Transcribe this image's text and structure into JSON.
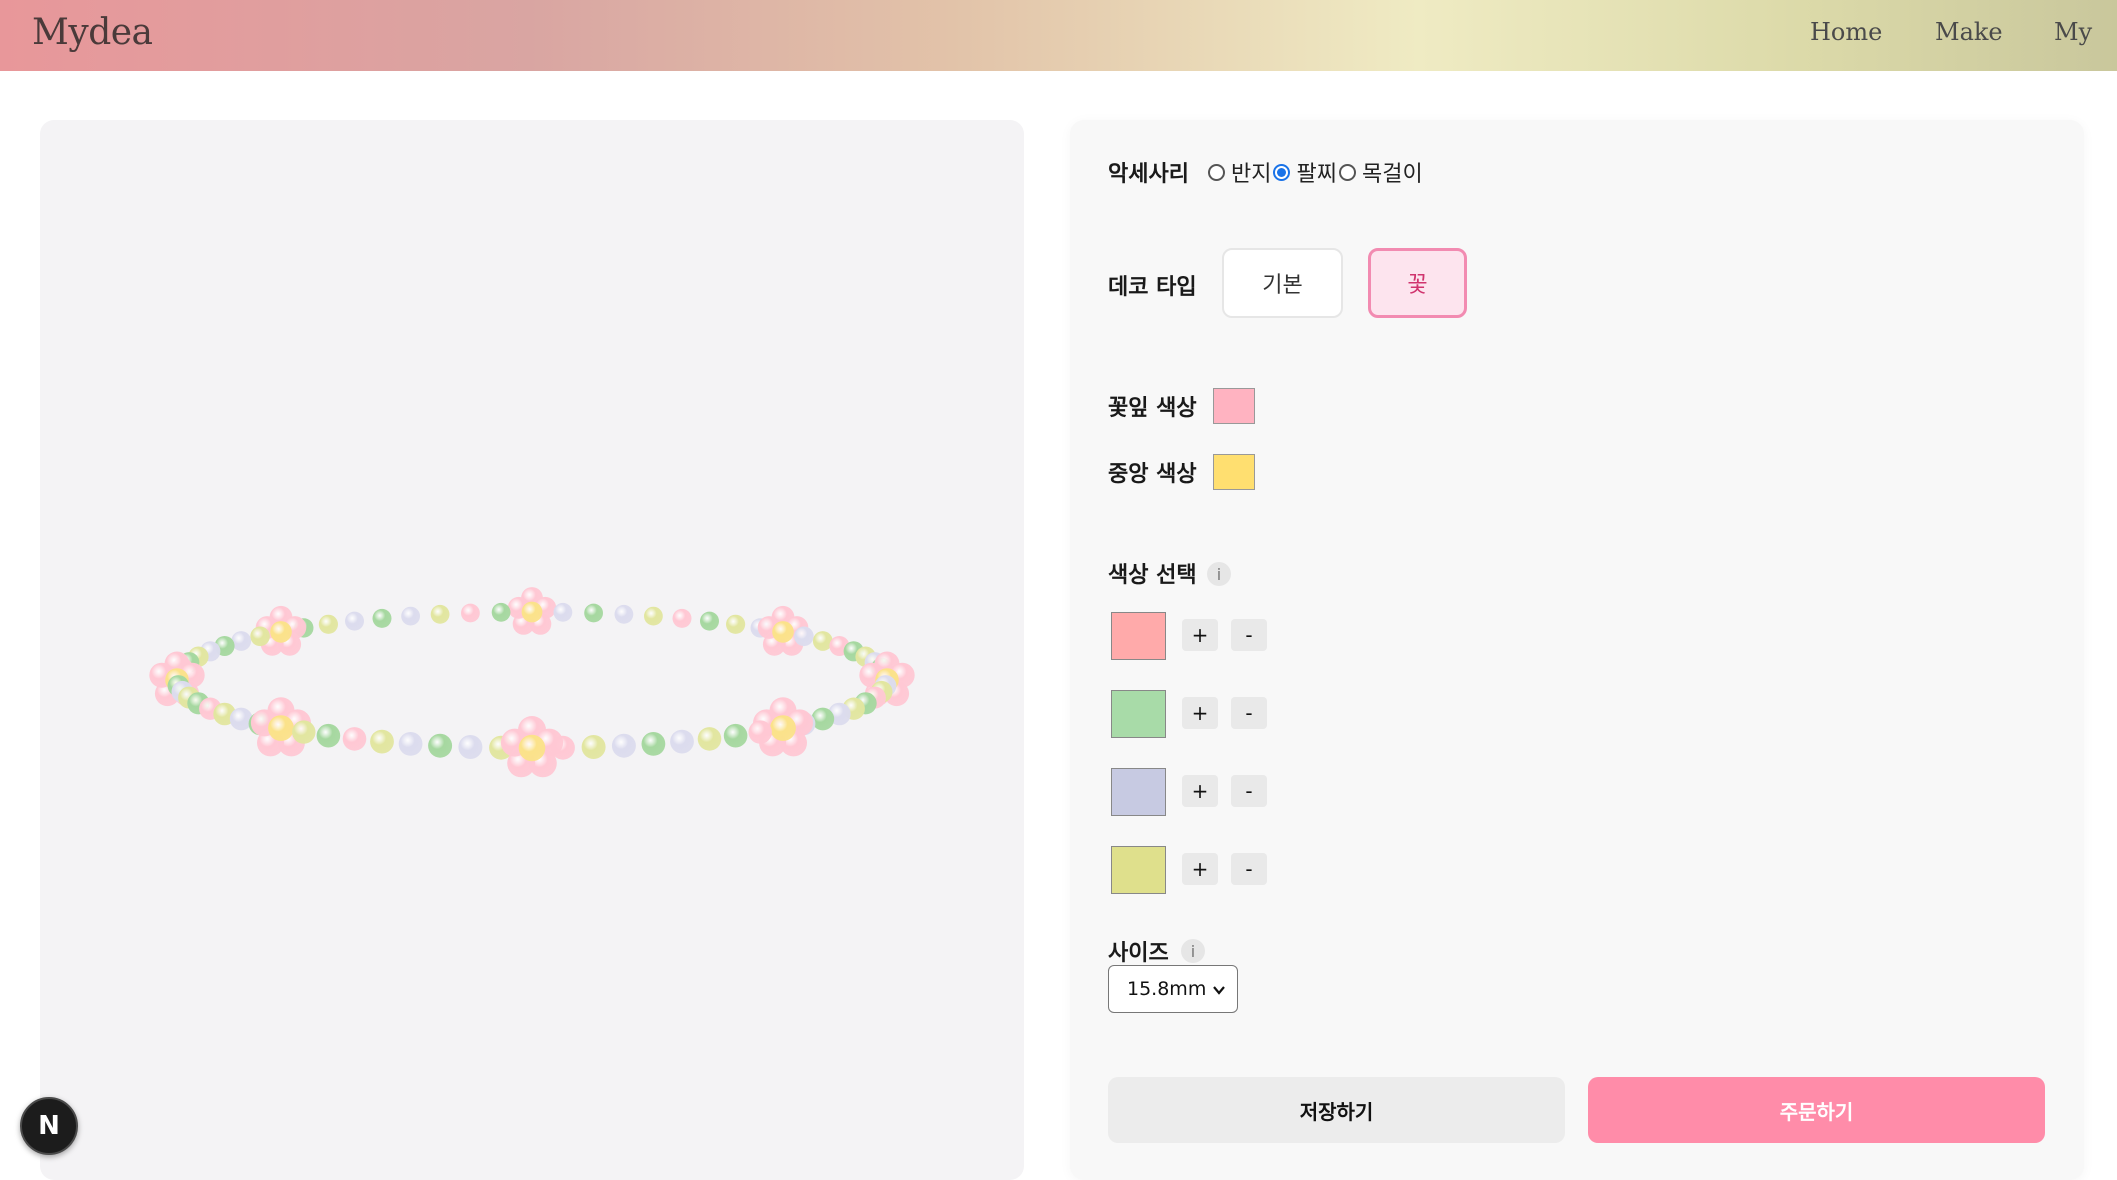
{
  "header": {
    "logo": "Mydea",
    "nav": [
      "Home",
      "Make",
      "My"
    ]
  },
  "accessory": {
    "label": "악세사리",
    "options": [
      "반지",
      "팔찌",
      "목걸이"
    ],
    "selected": "팔찌"
  },
  "deco": {
    "label": "데코 타입",
    "options": [
      "기본",
      "꽃"
    ],
    "selected": "꽃"
  },
  "petal_color": {
    "label": "꽃잎 색상",
    "color": "#ffb3c1"
  },
  "center_color": {
    "label": "중앙 색상",
    "color": "#ffdf70"
  },
  "color_select": {
    "label": "색상 선택",
    "info": "i",
    "colors": [
      "#ffaaaa",
      "#a8dba8",
      "#c7cae2",
      "#dfe08c"
    ],
    "plus": "+",
    "minus": "-"
  },
  "size": {
    "label": "사이즈",
    "info": "i",
    "value": "15.8mm"
  },
  "actions": {
    "save": "저장하기",
    "order": "주문하기"
  },
  "badge": "N",
  "bead_palette": {
    "petal": "#ffc8d4",
    "center": "#fbe28a",
    "green": "#a6d8a0",
    "lavender": "#dcdcee",
    "yellowgreen": "#e2e6a0"
  }
}
